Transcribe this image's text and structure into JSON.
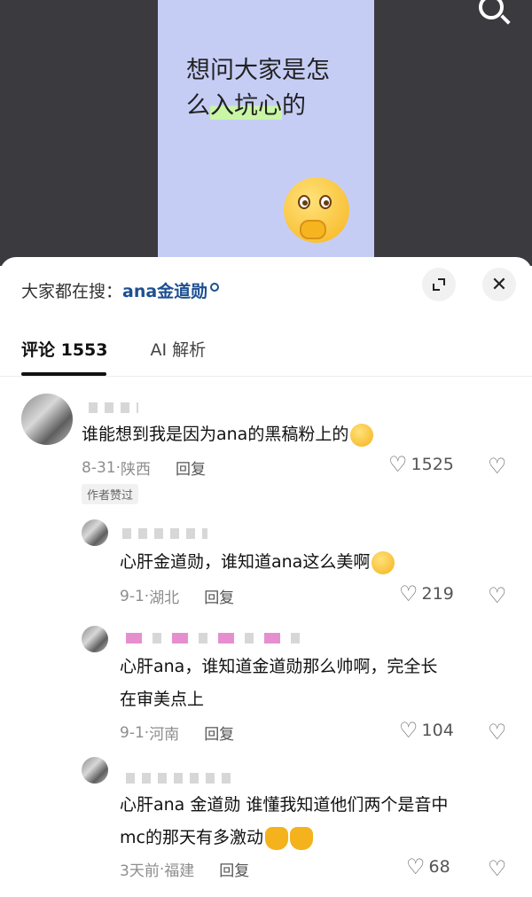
{
  "video": {
    "caption_line1": "想问大家是怎",
    "caption_line2_pre": "么",
    "caption_line2_hl": "入坑心",
    "caption_line2_post": "的"
  },
  "sheet": {
    "search_prefix": "大家都在搜：",
    "search_keyword": "ana金道勋",
    "close_glyph": "✕"
  },
  "tabs": [
    {
      "label": "评论 1553",
      "active": true
    },
    {
      "label": "AI 解析",
      "active": false
    }
  ],
  "comments": [
    {
      "text": "谁能想到我是因为ana的黑稿粉上的",
      "date": "8-31",
      "location": "陕西",
      "reply": "回复",
      "likes": "1525",
      "badge": "作者赞过"
    },
    {
      "text": "心肝金道勋，谁知道ana这么美啊",
      "date": "9-1",
      "location": "湖北",
      "reply": "回复",
      "likes": "219"
    },
    {
      "text_line1": "心肝ana，谁知道金道勋那么帅啊，完全长",
      "text_line2": "在审美点上",
      "date": "9-1",
      "location": "河南",
      "reply": "回复",
      "likes": "104"
    },
    {
      "text_line1": "心肝ana 金道勋 谁懂我知道他们两个是音中",
      "text_line2": "mc的那天有多激动",
      "date": "3天前",
      "location": "福建",
      "reply": "回复",
      "likes": "68"
    }
  ],
  "separator": "·"
}
